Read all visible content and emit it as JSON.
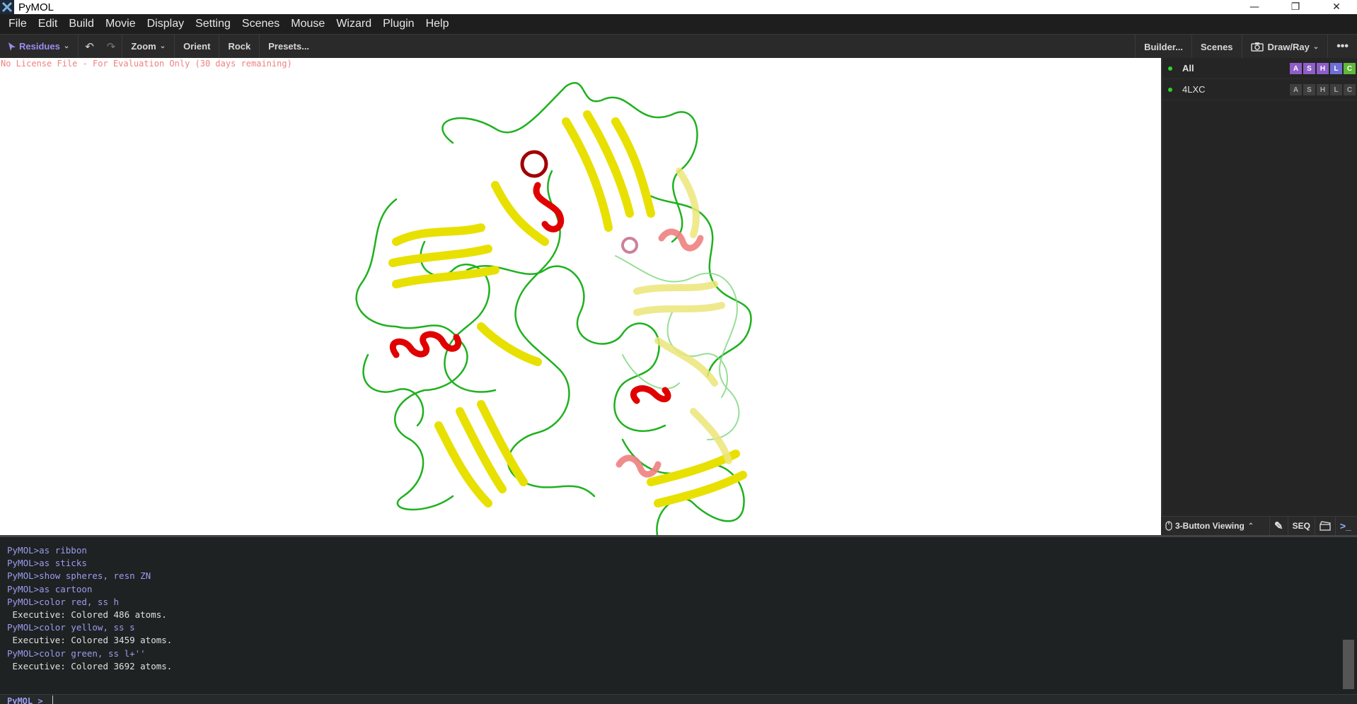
{
  "window": {
    "title": "PyMOL",
    "minimize": "—",
    "restore": "❐",
    "close": "✕"
  },
  "menu": [
    "File",
    "Edit",
    "Build",
    "Movie",
    "Display",
    "Setting",
    "Scenes",
    "Mouse",
    "Wizard",
    "Plugin",
    "Help"
  ],
  "toolbar": {
    "residues": "Residues",
    "zoom": "Zoom",
    "orient": "Orient",
    "rock": "Rock",
    "presets": "Presets...",
    "builder": "Builder...",
    "scenes": "Scenes",
    "draw_ray": "Draw/Ray",
    "more": "•••"
  },
  "viewport": {
    "license_text": "No License File - For Evaluation Only (30 days remaining)"
  },
  "objects": [
    {
      "name": "All",
      "buttons": [
        "A",
        "S",
        "H",
        "L",
        "C"
      ]
    },
    {
      "name": "4LXC",
      "buttons": [
        "A",
        "S",
        "H",
        "L",
        "C"
      ]
    }
  ],
  "object_button_colors": {
    "A": "#8e5ec8",
    "S": "#8e5ec8",
    "H": "#8e5ec8",
    "L": "#6f6fd8",
    "C": "#5fb83a"
  },
  "panel_footer": {
    "mouse_mode": "3-Button Viewing",
    "seq": "SEQ"
  },
  "console": {
    "lines": [
      {
        "type": "cmd",
        "text": "PyMOL>as ribbon"
      },
      {
        "type": "cmd",
        "text": "PyMOL>as sticks"
      },
      {
        "type": "cmd",
        "text": "PyMOL>show spheres, resn ZN"
      },
      {
        "type": "cmd",
        "text": "PyMOL>as cartoon"
      },
      {
        "type": "cmd",
        "text": "PyMOL>color red, ss h"
      },
      {
        "type": "out",
        "text": " Executive: Colored 486 atoms."
      },
      {
        "type": "cmd",
        "text": "PyMOL>color yellow, ss s"
      },
      {
        "type": "out",
        "text": " Executive: Colored 3459 atoms."
      },
      {
        "type": "cmd",
        "text": "PyMOL>color green, ss l+''"
      },
      {
        "type": "out",
        "text": " Executive: Colored 3692 atoms."
      }
    ],
    "prompt": "PyMOL >"
  }
}
